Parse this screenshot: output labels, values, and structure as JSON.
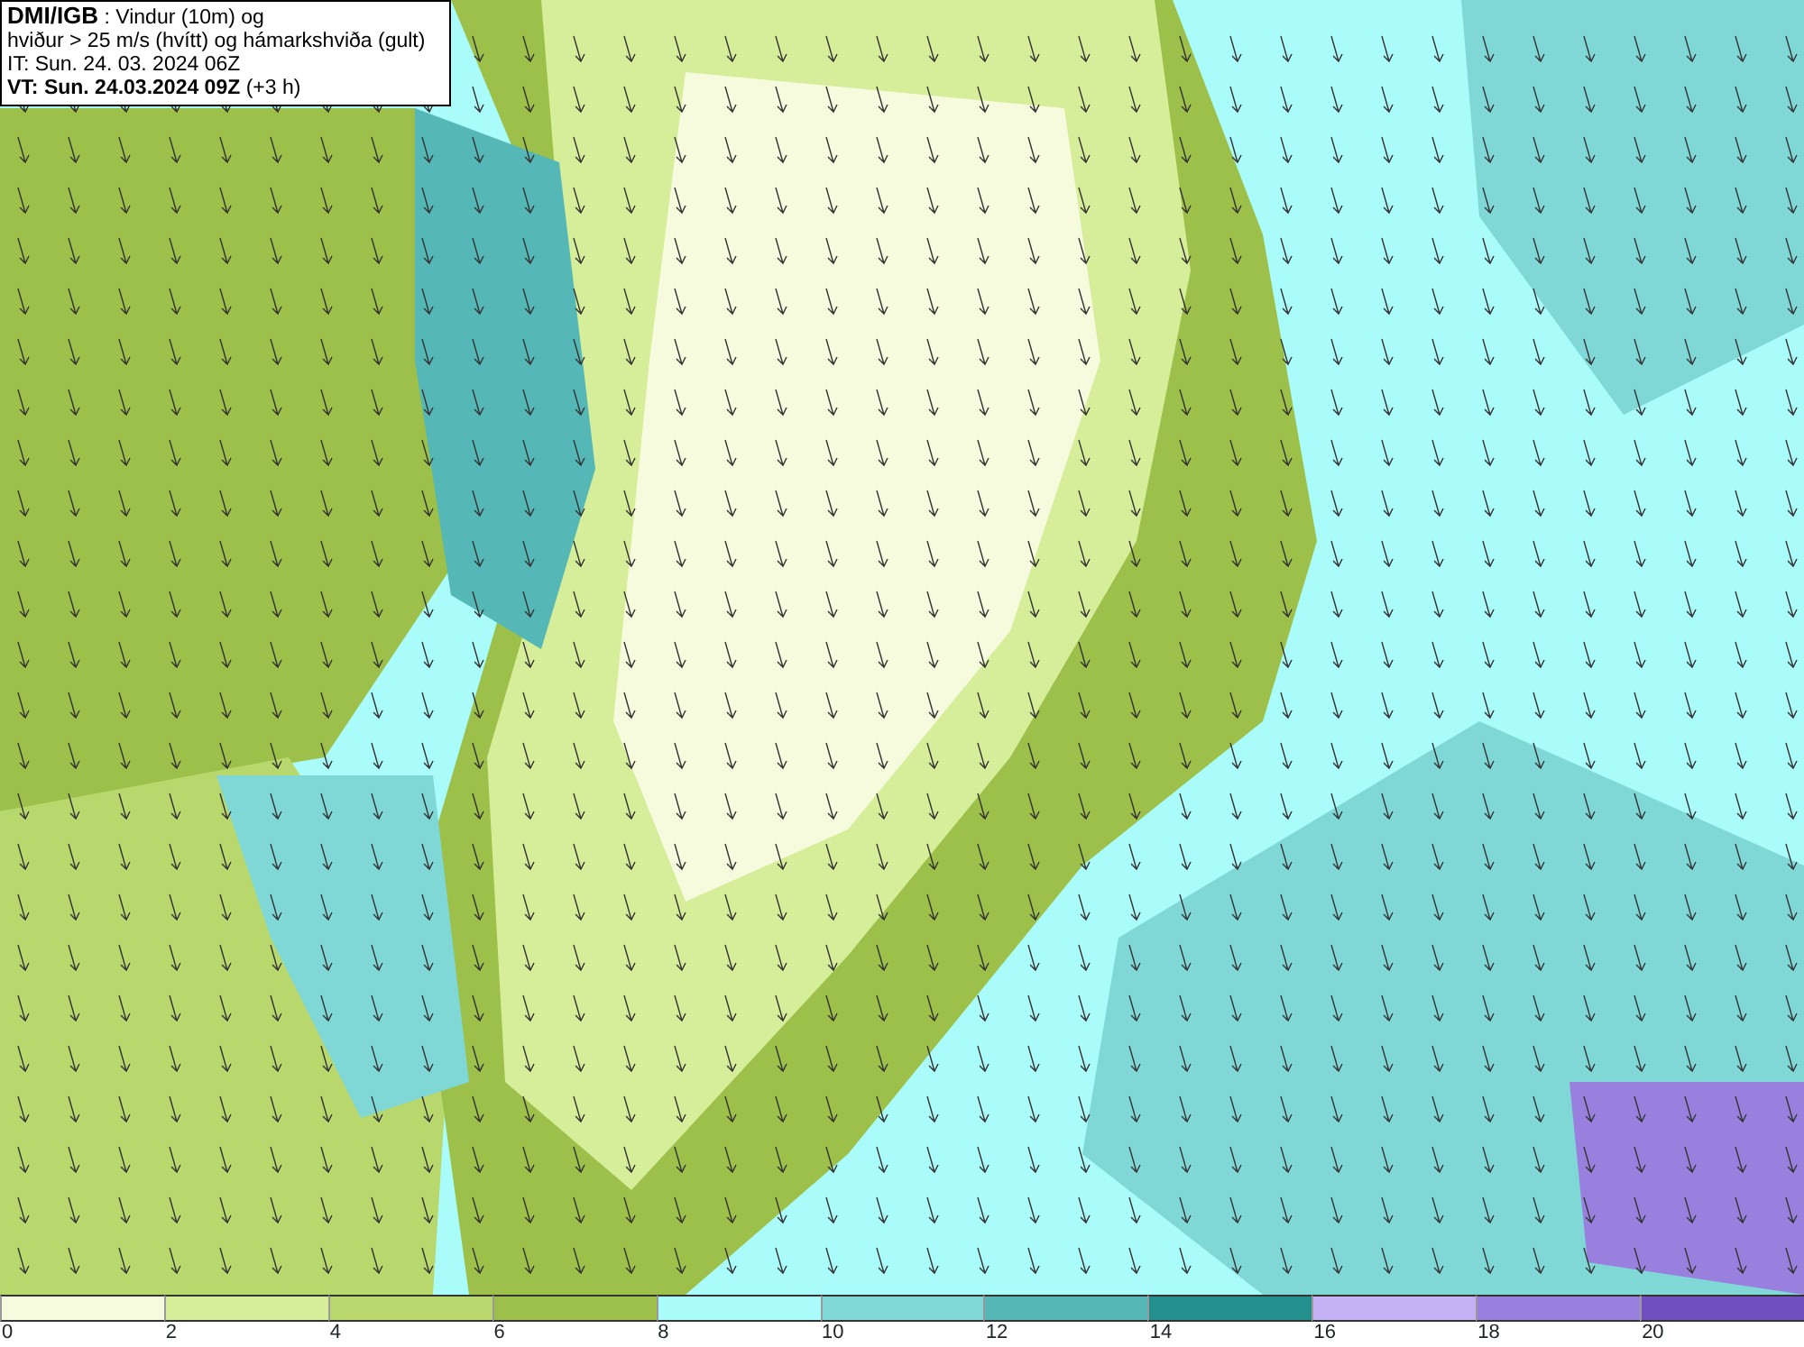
{
  "title_box": {
    "lines": [
      "**DMI/IGB** : Vindur (10m) og",
      "hviður > 25 m/s (hvítt) og hámarkshviða (gult)",
      "IT: Sun. 24. 03. 2024 06Z",
      "**VT: Sun. 24.03.2024 09Z** (+3 h)"
    ]
  },
  "legend": {
    "segments": [
      {
        "label": "0",
        "color": "#f5fbdc"
      },
      {
        "label": "2",
        "color": "#d6ed9a"
      },
      {
        "label": "4",
        "color": "#b8d86e"
      },
      {
        "label": "6",
        "color": "#9cc04a"
      },
      {
        "label": "8",
        "color": "#aafcfa"
      },
      {
        "label": "10",
        "color": "#7fd8d6"
      },
      {
        "label": "12",
        "color": "#55b8b6"
      },
      {
        "label": "14",
        "color": "#23908e"
      },
      {
        "label": "16",
        "color": "#c4b2f4"
      },
      {
        "label": "18",
        "color": "#9a80de"
      },
      {
        "label": "20",
        "color": "#7050c0"
      }
    ]
  }
}
